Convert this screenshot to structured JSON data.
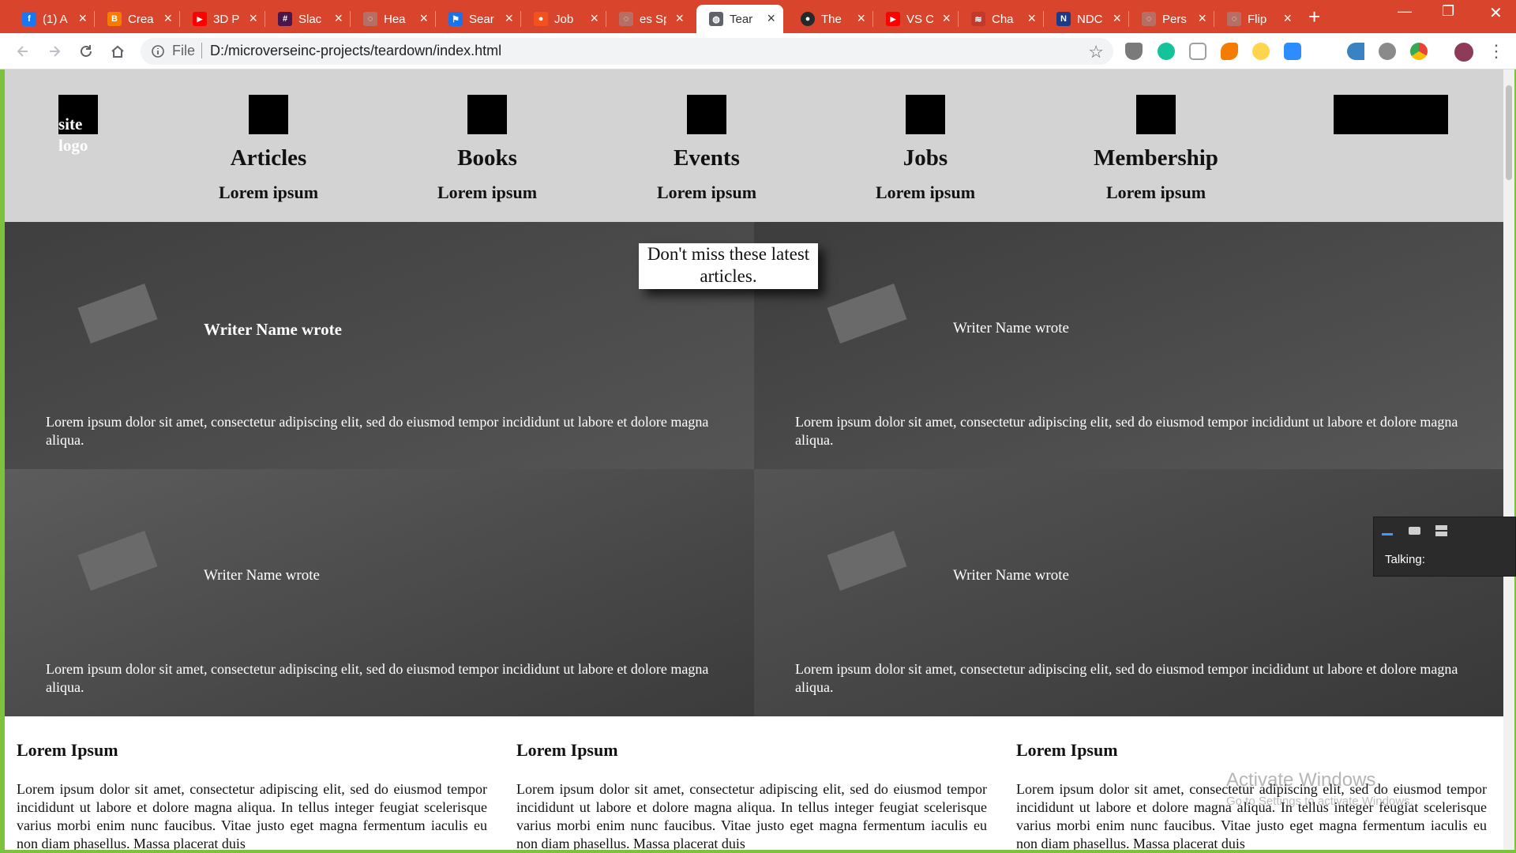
{
  "browser": {
    "tabs": [
      {
        "title": "(1) A",
        "fav_color": "#1877f2",
        "fav_glyph": "f"
      },
      {
        "title": "Crea",
        "fav_color": "#f57d00",
        "fav_glyph": "B"
      },
      {
        "title": "3D P",
        "fav_color": "#ff0000",
        "fav_glyph": "▶"
      },
      {
        "title": "Slac",
        "fav_color": "#4a154b",
        "fav_glyph": "#"
      },
      {
        "title": "Hea",
        "fav_color": "#b56f64",
        "fav_glyph": "◌"
      },
      {
        "title": "Sear",
        "fav_color": "#1a73e8",
        "fav_glyph": "⚑"
      },
      {
        "title": "Job",
        "fav_color": "#f4511e",
        "fav_glyph": "●"
      },
      {
        "title": "es Sp",
        "fav_color": "#b56f64",
        "fav_glyph": "◌"
      },
      {
        "title": "Tear",
        "fav_color": "#5f6368",
        "fav_glyph": "◍"
      },
      {
        "title": "The",
        "fav_color": "#24292e",
        "fav_glyph": "●"
      },
      {
        "title": "VS C",
        "fav_color": "#ff0000",
        "fav_glyph": "▶"
      },
      {
        "title": "Cha",
        "fav_color": "#c0392b",
        "fav_glyph": "≋"
      },
      {
        "title": "NDC",
        "fav_color": "#1b3a8c",
        "fav_glyph": "N"
      },
      {
        "title": "Pers",
        "fav_color": "#b56f64",
        "fav_glyph": "◌"
      },
      {
        "title": "Flip",
        "fav_color": "#b56f64",
        "fav_glyph": "◌"
      }
    ],
    "address": {
      "scheme": "File",
      "url": "D:/microverseinc-projects/teardown/index.html"
    },
    "extension_icons": [
      "shield-ext-icon",
      "grammarly-icon",
      "clipper-icon",
      "paw-icon",
      "moon-icon",
      "zoom-icon",
      "back-arrow-icon",
      "bug-icon",
      "chrome-ext-icon",
      "profile-avatar"
    ]
  },
  "site": {
    "logo_text": "site logo",
    "nav": [
      {
        "title": "Articles",
        "sub": "Lorem ipsum"
      },
      {
        "title": "Books",
        "sub": "Lorem ipsum"
      },
      {
        "title": "Events",
        "sub": "Lorem ipsum"
      },
      {
        "title": "Jobs",
        "sub": "Lorem ipsum"
      },
      {
        "title": "Membership",
        "sub": "Lorem ipsum"
      }
    ],
    "banner": "Don't miss these latest articles.",
    "articles": [
      {
        "writer": "Writer Name wrote",
        "text": "Lorem ipsum dolor sit amet, consectetur adipiscing elit, sed do eiusmod tempor incididunt ut labore et dolore magna aliqua."
      },
      {
        "writer": "Writer Name wrote",
        "text": "Lorem ipsum dolor sit amet, consectetur adipiscing elit, sed do eiusmod tempor incididunt ut labore et dolore magna aliqua."
      },
      {
        "writer": "Writer Name wrote",
        "text": "Lorem ipsum dolor sit amet, consectetur adipiscing elit, sed do eiusmod tempor incididunt ut labore et dolore magna aliqua."
      },
      {
        "writer": "Writer Name wrote",
        "text": "Lorem ipsum dolor sit amet, consectetur adipiscing elit, sed do eiusmod tempor incididunt ut labore et dolore magna aliqua."
      }
    ],
    "columns": [
      {
        "title": "Lorem Ipsum",
        "text": "Lorem ipsum dolor sit amet, consectetur adipiscing elit, sed do eiusmod tempor incididunt ut labore et dolore magna aliqua. In tellus integer feugiat scelerisque varius morbi enim nunc faucibus. Vitae justo eget magna fermentum iaculis eu non diam phasellus. Massa placerat duis"
      },
      {
        "title": "Lorem Ipsum",
        "text": "Lorem ipsum dolor sit amet, consectetur adipiscing elit, sed do eiusmod tempor incididunt ut labore et dolore magna aliqua. In tellus integer feugiat scelerisque varius morbi enim nunc faucibus. Vitae justo eget magna fermentum iaculis eu non diam phasellus. Massa placerat duis"
      },
      {
        "title": "Lorem Ipsum",
        "text": "Lorem ipsum dolor sit amet, consectetur adipiscing elit, sed do eiusmod tempor incididunt ut labore et dolore magna aliqua. In tellus integer feugiat scelerisque varius morbi enim nunc faucibus. Vitae justo eget magna fermentum iaculis eu non diam phasellus. Massa placerat duis"
      }
    ]
  },
  "overlay": {
    "watermark_title": "Activate Windows",
    "watermark_sub": "Go to Settings to activate Windows.",
    "talk_label": "Talking:"
  },
  "colors": {
    "tabbar": "#d8452c",
    "header_bg": "#d3d3d3",
    "desktop_border": "#7cc23f"
  }
}
